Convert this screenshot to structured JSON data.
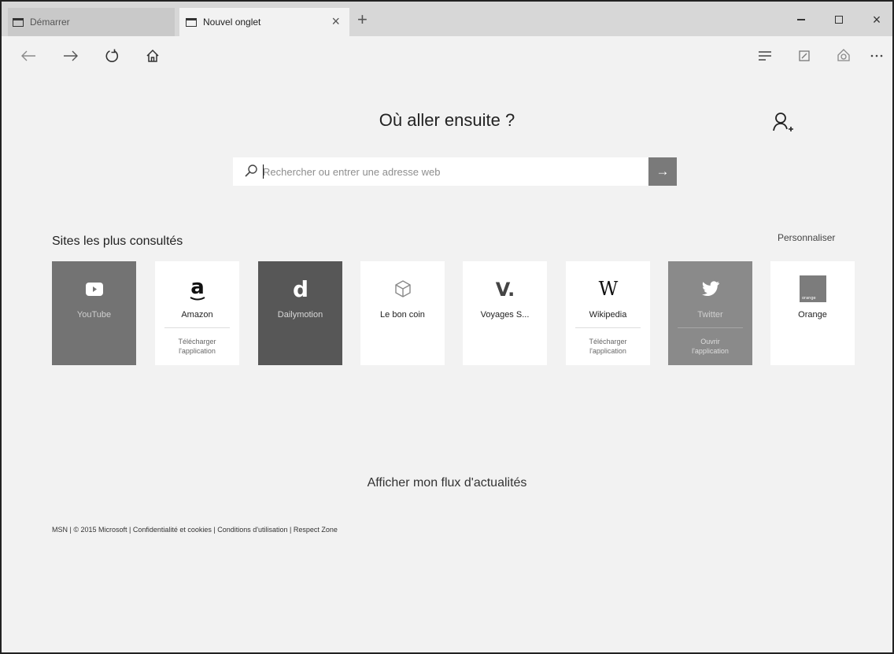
{
  "tabs": [
    {
      "label": "Démarrer"
    },
    {
      "label": "Nouvel onglet"
    }
  ],
  "window_controls": {
    "close_glyph": "×",
    "new_tab_glyph": "+"
  },
  "nav_icons": [
    "back-arrow-icon",
    "forward-arrow-icon",
    "refresh-icon",
    "home-icon",
    "hub-icon",
    "web-note-icon",
    "share-icon",
    "more-icon"
  ],
  "page": {
    "heading": "Où aller ensuite ?",
    "search_placeholder": "Rechercher ou entrer une adresse web",
    "search_go": "→",
    "top_sites_title": "Sites les plus consultés",
    "customize_label": "Personnaliser",
    "news_link": "Afficher mon flux d'actualités"
  },
  "top_sites": [
    {
      "name": "YouTube",
      "logo": "▶",
      "action": ""
    },
    {
      "name": "Amazon",
      "logo": "a",
      "action": "Télécharger\nl'application"
    },
    {
      "name": "Dailymotion",
      "logo": "d",
      "action": ""
    },
    {
      "name": "Le bon coin",
      "logo": "",
      "action": ""
    },
    {
      "name": "Voyages S...",
      "logo": "V.",
      "action": ""
    },
    {
      "name": "Wikipedia",
      "logo": "W",
      "action": "Télécharger\nl'application"
    },
    {
      "name": "Twitter",
      "logo": "",
      "action": "Ouvrir\nl'application"
    },
    {
      "name": "Orange",
      "logo": "orange",
      "action": ""
    }
  ],
  "footer": {
    "msn": "MSN",
    "copyright": "© 2015 Microsoft",
    "privacy": "Confidentialité et cookies",
    "terms": "Conditions d'utilisation",
    "respect": "Respect Zone",
    "separator": " | "
  },
  "colors": {
    "tabbar": "#d7d7d7",
    "page_bg": "#f2f2f2",
    "go_button": "#7a7a7a",
    "youtube_tile": "#737373",
    "dailymotion_tile": "#575757",
    "twitter_tile": "#8a8a8a"
  }
}
